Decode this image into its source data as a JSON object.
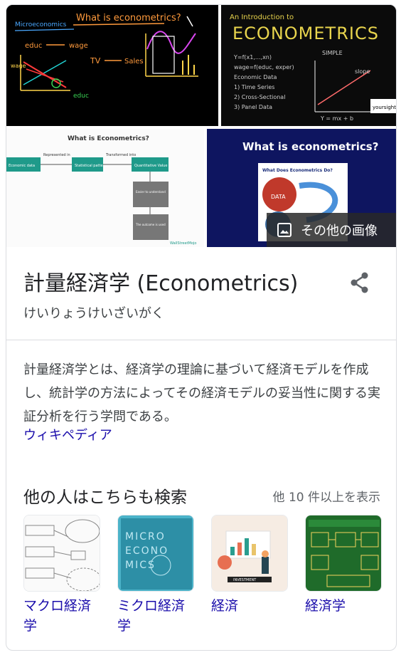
{
  "images": {
    "img1": {
      "title": "What is econometrics?",
      "top_label": "Microeconomics",
      "labels": [
        "educ",
        "wage",
        "TV",
        "Sales",
        "educ",
        "wage"
      ]
    },
    "img2": {
      "line1": "An Introduction to",
      "line2": "ECONOMETRICS",
      "side_label": "SIMPLE"
    },
    "img3": {
      "title": "What is Econometrics?",
      "boxes": [
        "Economic data",
        "Statistical pattern",
        "Quantitative Value"
      ],
      "arrows": [
        "Represented in",
        "Transformed into"
      ],
      "notes": [
        "Easier to understand and extract for further financial/economic decision making",
        "The outcome is used as a ready reference to future markets involving similar dataset or situations"
      ]
    },
    "img4": {
      "title": "What is econometrics?",
      "box_title": "What Does Econometrics Do?",
      "data_label": "DATA"
    },
    "more_images_label": "その他の画像"
  },
  "entity": {
    "title": "計量経済学 (Econometrics)",
    "reading": "けいりょうけいざいがく"
  },
  "description": {
    "text": "計量経済学とは、経済学の理論に基づいて経済モデルを作成し、統計学の方法によってその経済モデルの妥当性に関する実証分析を行う学問である。",
    "source": "ウィキペディア"
  },
  "also_searched": {
    "heading": "他の人はこちらも検索",
    "show_more": "他 10 件以上を表示",
    "items": [
      {
        "label": "マクロ経済学"
      },
      {
        "label": "ミクロ経済学",
        "thumb_text": "MICRO ECONO MICS"
      },
      {
        "label": "経済",
        "thumb_text": "INVESTMENT"
      },
      {
        "label": "経済学"
      }
    ]
  },
  "colors": {
    "link": "#1a0dab",
    "divider": "#dadce0",
    "img4_bg": "#0e1560"
  }
}
